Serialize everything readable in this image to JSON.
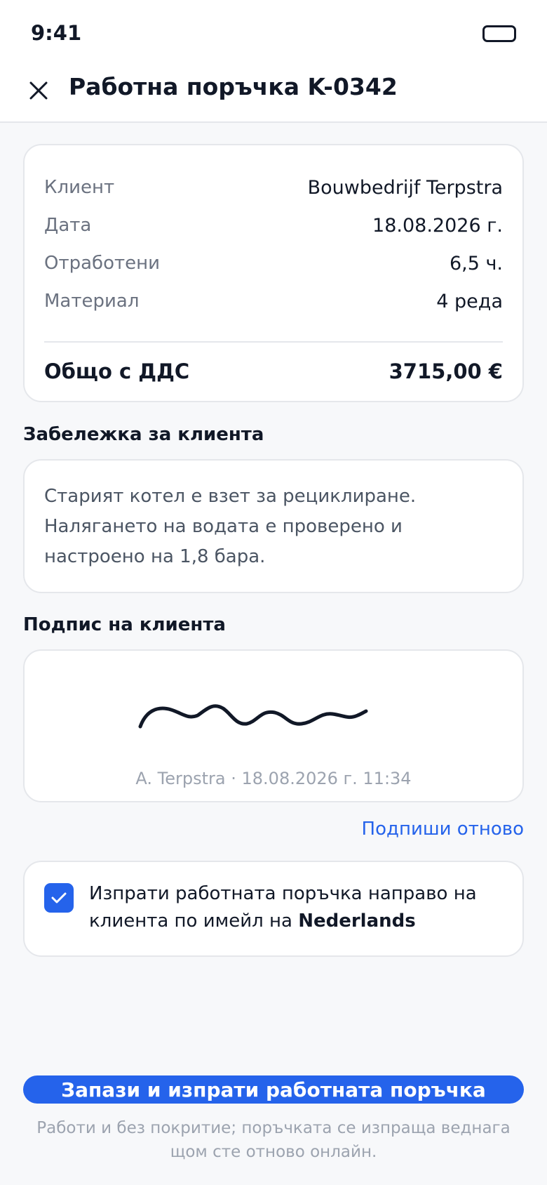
{
  "status_bar": {
    "time": "9:41"
  },
  "header": {
    "title": "Работна поръчка K-0342"
  },
  "summary": {
    "rows": [
      {
        "label": "Клиент",
        "value": "Bouwbedrijf Terpstra"
      },
      {
        "label": "Дата",
        "value": "18.08.2026 г."
      },
      {
        "label": "Отработени",
        "value": "6,5 ч."
      },
      {
        "label": "Материал",
        "value": "4 реда"
      }
    ],
    "total": {
      "label": "Общо с ДДС",
      "value": "3715,00 €"
    }
  },
  "note": {
    "label": "Забележка за клиента",
    "text": "Старият котел е взет за рециклиране. Налягането на водата е проверено и настроено на 1,8 бара."
  },
  "signature": {
    "label": "Подпис на клиента",
    "caption": "A. Terpstra · 18.08.2026 г. 11:34",
    "resign_label": "Подпиши отново"
  },
  "email_option": {
    "checked": true,
    "text_prefix": "Изпрати работната поръчка направо на клиента по имейл на ",
    "language": "Nederlands"
  },
  "actions": {
    "submit_label": "Запази и изпрати работната поръчка",
    "offline_note": "Работи и без покритие; поръчката се изпраща веднага щом сте отново онлайн."
  },
  "colors": {
    "accent": "#2563EB",
    "text": "#111827",
    "muted": "#6B7280",
    "background": "#F7F8FA"
  }
}
